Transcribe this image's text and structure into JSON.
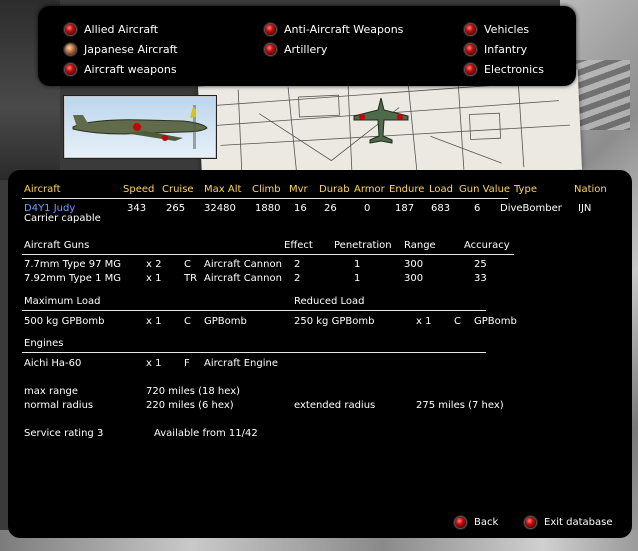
{
  "menu": {
    "allied_aircraft": "Allied Aircraft",
    "japanese_aircraft": "Japanese Aircraft",
    "aircraft_weapons": "Aircraft weapons",
    "anti_aircraft_weapons": "Anti-Aircraft Weapons",
    "artillery": "Artillery",
    "vehicles": "Vehicles",
    "infantry": "Infantry",
    "electronics": "Electronics",
    "active_item": "Japanese Aircraft"
  },
  "header": {
    "aircraft": "Aircraft",
    "speed": "Speed",
    "cruise": "Cruise",
    "max_alt": "Max Alt",
    "climb": "Climb",
    "mvr": "Mvr",
    "durab": "Durab",
    "armor": "Armor",
    "endure": "Endure",
    "load": "Load",
    "gun_value": "Gun Value",
    "type": "Type",
    "nation": "Nation"
  },
  "aircraft": {
    "name": "D4Y1 Judy",
    "note": "Carrier capable",
    "speed": "343",
    "cruise": "265",
    "max_alt": "32480",
    "climb": "1880",
    "mvr": "16",
    "durab": "26",
    "armor": "0",
    "endure": "187",
    "load": "683",
    "gun_value": "6",
    "type": "DiveBomber",
    "nation": "IJN"
  },
  "guns": {
    "title": "Aircraft Guns",
    "col_effect": "Effect",
    "col_penetration": "Penetration",
    "col_range": "Range",
    "col_accuracy": "Accuracy",
    "rows": [
      {
        "name": "7.7mm Type 97 MG",
        "qty": "x 2",
        "pos": "C",
        "kind": "Aircraft Cannon",
        "effect": "2",
        "penetration": "1",
        "range": "300",
        "accuracy": "25"
      },
      {
        "name": "7.92mm Type 1 MG",
        "qty": "x 1",
        "pos": "TR",
        "kind": "Aircraft Cannon",
        "effect": "2",
        "penetration": "1",
        "range": "300",
        "accuracy": "33"
      }
    ]
  },
  "loads": {
    "max_title": "Maximum Load",
    "reduced_title": "Reduced Load",
    "max": {
      "name": "500 kg GPBomb",
      "qty": "x 1",
      "pos": "C",
      "kind": "GPBomb"
    },
    "reduced": {
      "name": "250 kg GPBomb",
      "qty": "x 1",
      "pos": "C",
      "kind": "GPBomb"
    }
  },
  "engines": {
    "title": "Engines",
    "name": "Aichi Ha-60",
    "qty": "x 1",
    "pos": "F",
    "kind": "Aircraft Engine"
  },
  "ranges": {
    "max_range_label": "max range",
    "max_range_value": "720 miles (18 hex)",
    "normal_radius_label": "normal radius",
    "normal_radius_value": "220 miles (6 hex)",
    "extended_radius_label": "extended radius",
    "extended_radius_value": "275 miles (7 hex)"
  },
  "service": {
    "rating": "Service rating 3",
    "available": "Available from  11/42"
  },
  "buttons": {
    "back": "Back",
    "exit": "Exit database"
  },
  "colors": {
    "header_yellow": "#ffd84a",
    "aircraft_name_blue": "#6aa0ff",
    "panel_black": "#000000",
    "led_red": "#c01010"
  }
}
